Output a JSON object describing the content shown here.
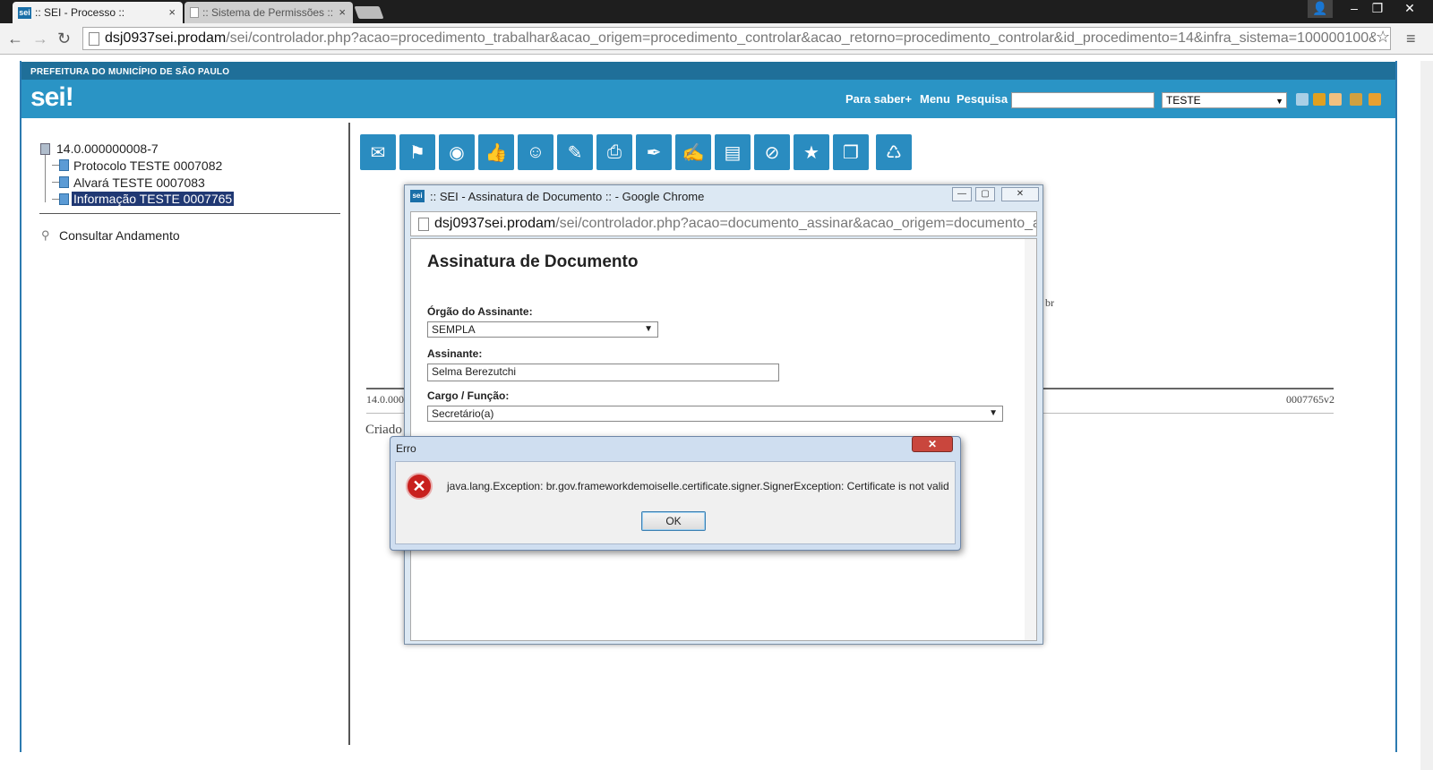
{
  "browser": {
    "tabs": [
      {
        "favicon": "sei",
        "title": ":: SEI - Processo ::",
        "close": "×"
      },
      {
        "favicon": "page",
        "title": ":: Sistema de Permissões ::",
        "close": "×"
      }
    ],
    "window_buttons": {
      "user": "👤",
      "minimize": "–",
      "maximize": "❐",
      "close": "✕"
    },
    "nav": {
      "back": "←",
      "forward": "→",
      "reload": "↻",
      "star": "☆",
      "menu": "≡"
    },
    "url_host": "dsj0937sei.prodam",
    "url_path": "/sei/controlador.php?acao=procedimento_trabalhar&acao_origem=procedimento_controlar&acao_retorno=procedimento_controlar&id_procedimento=14&infra_sistema=100000100&"
  },
  "header": {
    "org": "PREFEITURA DO MUNICÍPIO DE SÃO PAULO",
    "logo": "sei!",
    "links": [
      "Para saber+",
      "Menu",
      "Pesquisa"
    ],
    "unit": "TESTE",
    "dropdown_arrow": "▼"
  },
  "tree": {
    "process": "14.0.000000008-7",
    "items": [
      "Protocolo TESTE 0007082",
      "Alvará TESTE 0007083",
      "Informação TESTE 0007765"
    ],
    "consultar": "Consultar Andamento"
  },
  "toolbar_icons": [
    "envelope-icon",
    "users-icon",
    "eye-icon",
    "thumbs-up-icon",
    "people-icon",
    "scroll-icon",
    "printer-icon",
    "pen-icon",
    "signer-icon",
    "books-icon",
    "cancel-icon",
    "document-star-icon",
    "copy-icon",
    "trash-icon"
  ],
  "toolbar_glyphs": [
    "✉",
    "⚑",
    "◉",
    "👍",
    "☺",
    "✎",
    "⎙",
    "✒",
    "✍",
    "▤",
    "⊘",
    "★",
    "❐",
    "♺"
  ],
  "document": {
    "left_ref": "14.0.000",
    "right_ref": "0007765v2",
    "mid_fragment": "br",
    "created": "Criado"
  },
  "popup": {
    "title": ":: SEI - Assinatura de Documento :: - Google Chrome",
    "favicon": "sei",
    "buttons": {
      "minimize": "—",
      "maximize": "▢",
      "close": "✕"
    },
    "url_host": "dsj0937sei.prodam",
    "url_path": "/sei/controlador.php?acao=documento_assinar&acao_origem=documento_as",
    "form": {
      "heading": "Assinatura de Documento",
      "orgao_label": "Órgão do Assinante:",
      "orgao_value": "SEMPLA",
      "assinante_label": "Assinante:",
      "assinante_value": "Selma Berezutchi",
      "cargo_label": "Cargo / Função:",
      "cargo_value": "Secretário(a)"
    }
  },
  "error_dialog": {
    "title": "Erro",
    "close": "✕",
    "icon": "✕",
    "message": "java.lang.Exception: br.gov.frameworkdemoiselle.certificate.signer.SignerException: Certificate is not valid",
    "ok": "OK"
  }
}
